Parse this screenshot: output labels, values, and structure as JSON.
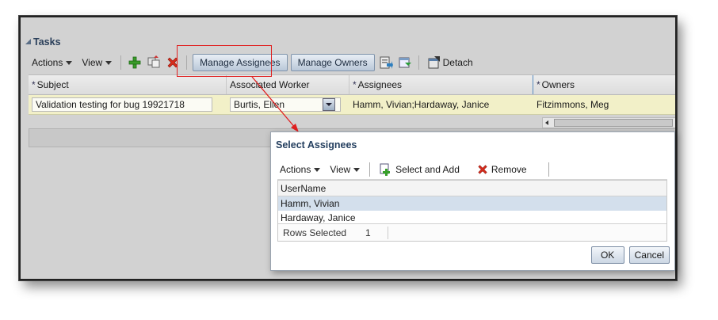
{
  "section": {
    "title": "Tasks"
  },
  "toolbar": {
    "actions": "Actions",
    "view": "View",
    "manage_assignees": "Manage Assignees",
    "manage_owners": "Manage Owners",
    "detach": "Detach"
  },
  "table": {
    "headers": [
      "Subject",
      "Associated Worker",
      "Assignees",
      "Owners"
    ],
    "required_mark": "*",
    "row": {
      "subject": "Validation testing for bug 19921718",
      "worker": "Burtis, Ellen",
      "assignees": "Hamm, Vivian;Hardaway, Janice",
      "owners": "Fitzimmons, Meg"
    }
  },
  "dialog": {
    "title": "Select Assignees",
    "actions": "Actions",
    "view": "View",
    "select_and_add": "Select and Add",
    "remove": "Remove",
    "column": "UserName",
    "rows": [
      "Hamm, Vivian",
      "Hardaway, Janice"
    ],
    "rows_selected_label": "Rows Selected",
    "rows_selected_value": "1",
    "ok": "OK",
    "cancel": "Cancel"
  },
  "colors": {
    "highlight": "#e02020",
    "selected_row": "#d3dfec",
    "edit_row": "#f2f0c8"
  }
}
